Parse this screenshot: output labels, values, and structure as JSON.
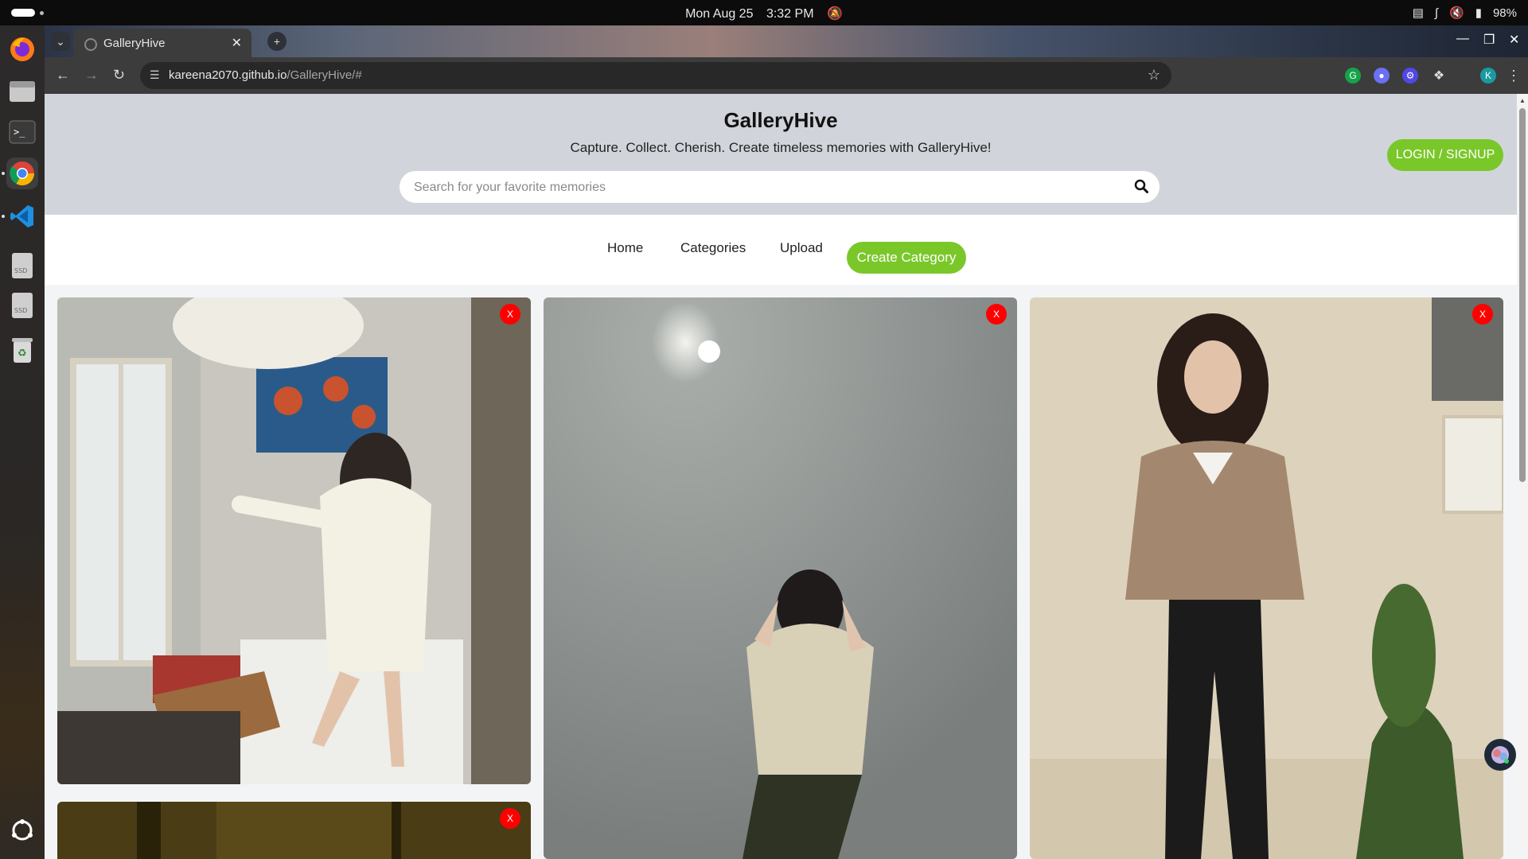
{
  "system": {
    "date": "Mon Aug 25",
    "time": "3:32 PM",
    "battery": "98%"
  },
  "browser": {
    "tab_title": "GalleryHive",
    "url_host": "kareena2070.github.io",
    "url_path": "/GalleryHive/#",
    "profile_initial": "K"
  },
  "site": {
    "title": "GalleryHive",
    "tagline": "Capture. Collect. Cherish. Create timeless memories with GalleryHive!",
    "search_placeholder": "Search for your favorite memories",
    "login_label": "LOGIN / SIGNUP",
    "nav": [
      "Home",
      "Categories",
      "Upload"
    ],
    "create_category_label": "Create Category"
  },
  "gallery": {
    "delete_label": "X",
    "accent_color": "#7ac72a",
    "delete_color": "#ff0000"
  }
}
